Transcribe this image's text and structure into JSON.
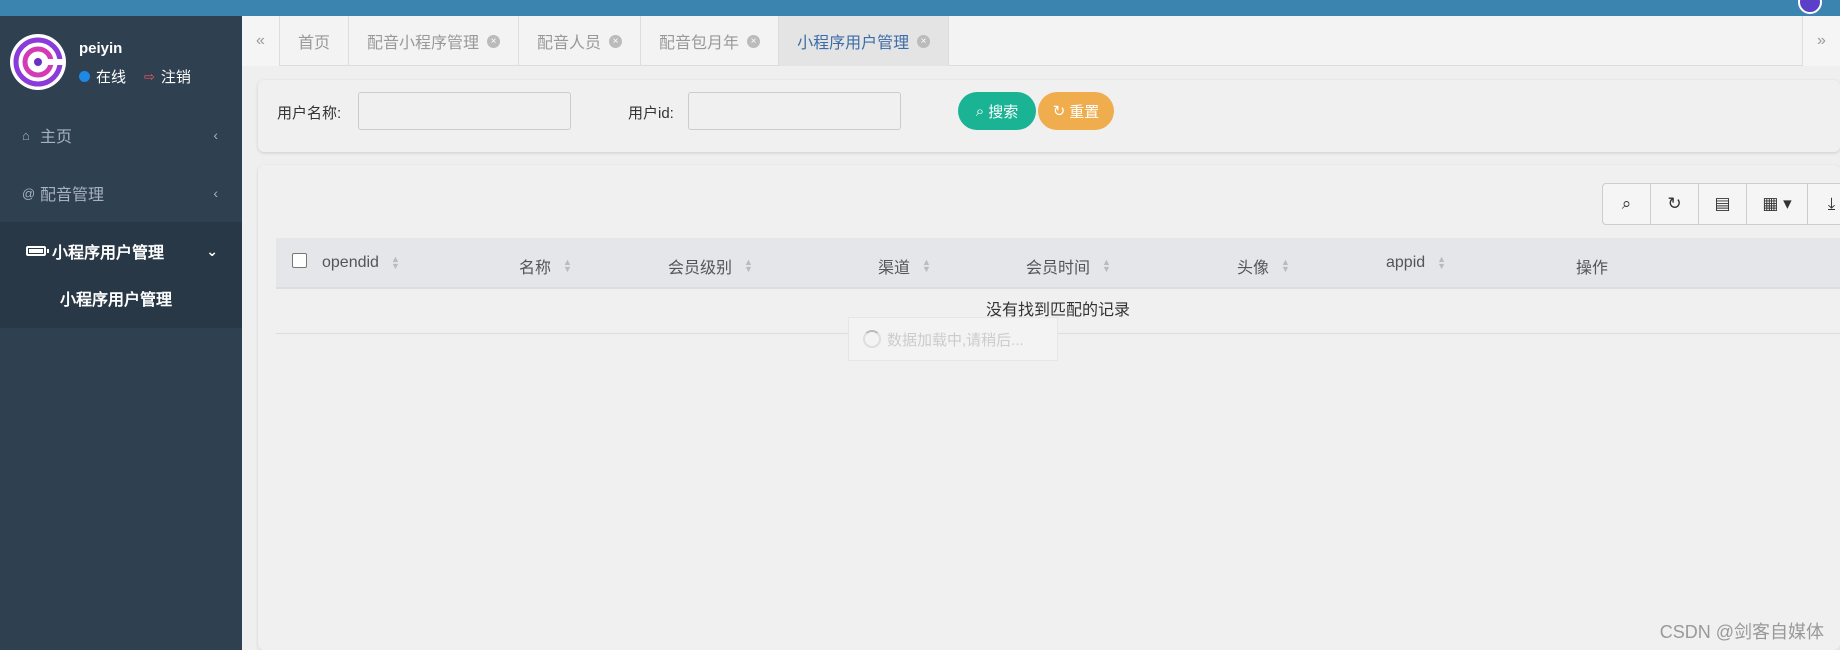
{
  "sidebar": {
    "username": "peiyin",
    "status_online": "在线",
    "status_logout": "注销",
    "menu": [
      {
        "label": "主页",
        "icon": "home-icon"
      },
      {
        "label": "配音管理",
        "icon": "at-icon"
      }
    ],
    "active_group": {
      "label": "小程序用户管理",
      "icon": "battery-icon",
      "sub_item": "小程序用户管理"
    }
  },
  "tabs": [
    {
      "label": "首页"
    },
    {
      "label": "配音小程序管理"
    },
    {
      "label": "配音人员"
    },
    {
      "label": "配音包月年"
    },
    {
      "label": "小程序用户管理",
      "active": true
    }
  ],
  "search": {
    "username_label": "用户名称:",
    "userid_label": "用户id:",
    "username_value": "",
    "userid_value": "",
    "search_button": "搜索",
    "reset_button": "重置"
  },
  "toolbar": [
    "search-icon",
    "refresh-icon",
    "toggle-view-icon",
    "columns-icon",
    "export-icon"
  ],
  "table": {
    "columns": [
      "opendid",
      "名称",
      "会员级别",
      "渠道",
      "会员时间",
      "头像",
      "appid",
      "操作"
    ],
    "empty_text": "没有找到匹配的记录",
    "loading_text": "数据加载中,请稍后..."
  },
  "watermark": "CSDN @剑客自媒体",
  "colors": {
    "topbar": "#3c84b0",
    "sidebar": "#2f4050",
    "search_button": "#1ab394",
    "reset_button": "#f0ad4e",
    "active_tab": "#3c6da8"
  }
}
